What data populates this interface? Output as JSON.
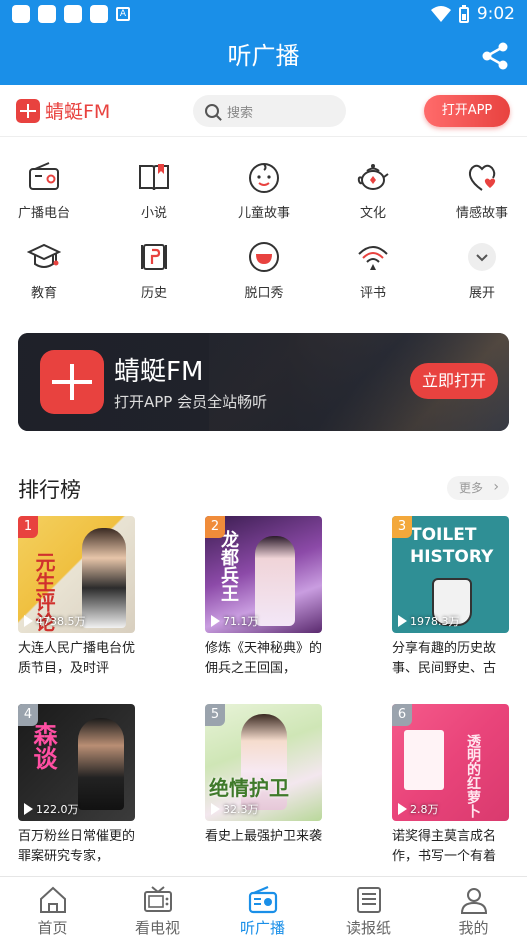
{
  "status_bar": {
    "time": "9:02"
  },
  "app_bar": {
    "title": "听广播"
  },
  "top_bar": {
    "logo": "蜻蜓FM",
    "search_placeholder": "搜索",
    "open_app": "打开APP"
  },
  "categories": [
    {
      "label": "广播电台",
      "icon": "radio-icon"
    },
    {
      "label": "小说",
      "icon": "book-icon"
    },
    {
      "label": "儿童故事",
      "icon": "child-face-icon"
    },
    {
      "label": "文化",
      "icon": "teapot-icon"
    },
    {
      "label": "情感故事",
      "icon": "heart-icon"
    },
    {
      "label": "教育",
      "icon": "graduation-cap-icon"
    },
    {
      "label": "历史",
      "icon": "scroll-icon"
    },
    {
      "label": "脱口秀",
      "icon": "mouth-icon"
    },
    {
      "label": "评书",
      "icon": "fan-icon"
    },
    {
      "label": "展开",
      "icon": "chevron-down-icon"
    }
  ],
  "banner": {
    "title": "蜻蜓FM",
    "subtitle": "打开APP 会员全站畅听",
    "button": "立即打开"
  },
  "ranking": {
    "title": "排行榜",
    "more": "更多",
    "items": [
      {
        "rank": "1",
        "plays": "4738.5万",
        "desc": "大连人民广播电台优质节目，及时评",
        "cover_text": "元生评论",
        "badge_color": "#e8423f"
      },
      {
        "rank": "2",
        "plays": "71.1万",
        "desc": "修炼《天神秘典》的佣兵之王回国，",
        "cover_text": "龙都兵王",
        "badge_color": "#f08c3a"
      },
      {
        "rank": "3",
        "plays": "1978.3万",
        "desc": "分享有趣的历史故事、民间野史、古",
        "cover_text": "TOILET HISTORY",
        "badge_color": "#f3a83b"
      },
      {
        "rank": "4",
        "plays": "122.0万",
        "desc": "百万粉丝日常催更的罪案研究专家，",
        "cover_text": "森谈",
        "badge_color": "#9aa3ad"
      },
      {
        "rank": "5",
        "plays": "32.3万",
        "desc": "看史上最强护卫来袭",
        "cover_text": "绝情护卫",
        "badge_color": "#9aa3ad"
      },
      {
        "rank": "6",
        "plays": "2.8万",
        "desc": "诺奖得主莫言成名作，书写一个有着",
        "cover_text": "透明的红萝卜",
        "badge_color": "#9aa3ad"
      }
    ]
  },
  "tabs": [
    {
      "label": "首页",
      "icon": "home-icon"
    },
    {
      "label": "看电视",
      "icon": "tv-icon"
    },
    {
      "label": "听广播",
      "icon": "radio-icon",
      "active": true
    },
    {
      "label": "读报纸",
      "icon": "newspaper-icon"
    },
    {
      "label": "我的",
      "icon": "user-icon"
    }
  ],
  "colors": {
    "primary": "#1a8fe8",
    "accent": "#e8423f"
  }
}
